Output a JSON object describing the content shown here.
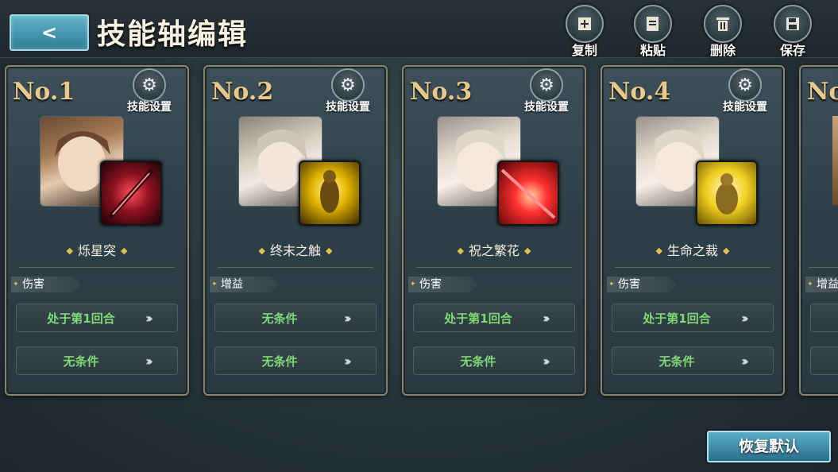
{
  "header": {
    "title": "技能轴编辑",
    "tools": [
      {
        "label": "复制",
        "icon": "copy-icon"
      },
      {
        "label": "粘贴",
        "icon": "paste-icon"
      },
      {
        "label": "删除",
        "icon": "trash-icon"
      },
      {
        "label": "保存",
        "icon": "save-icon"
      }
    ]
  },
  "cards": [
    {
      "no": "No.1",
      "settings_label": "技能设置",
      "skill": "烁星突",
      "tag": "伤害",
      "conditions": [
        "处于第1回合",
        "无条件"
      ]
    },
    {
      "no": "No.2",
      "settings_label": "技能设置",
      "skill": "终末之触",
      "tag": "增益",
      "conditions": [
        "无条件",
        "无条件"
      ]
    },
    {
      "no": "No.3",
      "settings_label": "技能设置",
      "skill": "祝之繁花",
      "tag": "伤害",
      "conditions": [
        "处于第1回合",
        "无条件"
      ]
    },
    {
      "no": "No.4",
      "settings_label": "技能设置",
      "skill": "生命之裁",
      "tag": "伤害",
      "conditions": [
        "处于第1回合",
        "无条件"
      ]
    },
    {
      "no": "No",
      "tag": "增益"
    }
  ],
  "footer": {
    "reset_label": "恢复默认"
  }
}
